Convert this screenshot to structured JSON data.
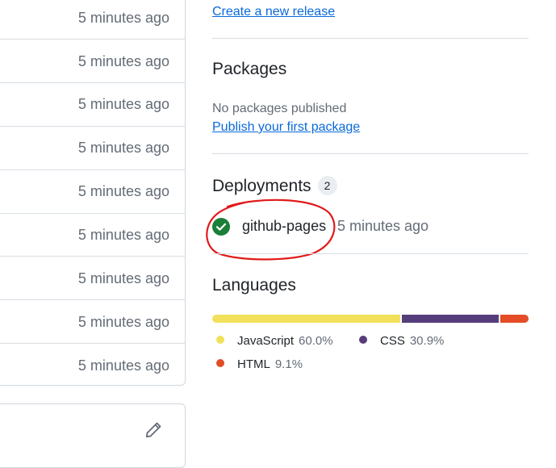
{
  "file_list": {
    "rows": [
      {
        "time": "5 minutes ago"
      },
      {
        "time": "5 minutes ago"
      },
      {
        "time": "5 minutes ago"
      },
      {
        "time": "5 minutes ago"
      },
      {
        "time": "5 minutes ago"
      },
      {
        "time": "5 minutes ago"
      },
      {
        "time": "5 minutes ago"
      },
      {
        "time": "5 minutes ago"
      },
      {
        "time": "5 minutes ago"
      }
    ]
  },
  "releases": {
    "create_link": "Create a new release"
  },
  "packages": {
    "title": "Packages",
    "empty_text": "No packages published",
    "publish_link": "Publish your first package"
  },
  "deployments": {
    "title": "Deployments",
    "count": "2",
    "items": [
      {
        "name": "github-pages",
        "time": "5 minutes ago",
        "status_color": "#1a7f37"
      }
    ],
    "annotation_color": "#e11a1a"
  },
  "languages": {
    "title": "Languages",
    "items": [
      {
        "name": "JavaScript",
        "percent": "60.0%",
        "value": 60.0,
        "color": "#f1e05a"
      },
      {
        "name": "CSS",
        "percent": "30.9%",
        "value": 30.9,
        "color": "#563d7c"
      },
      {
        "name": "HTML",
        "percent": "9.1%",
        "value": 9.1,
        "color": "#e34c26"
      }
    ]
  },
  "icons": {
    "edit": "pencil-icon",
    "deploy_status": "check-circle-icon"
  }
}
